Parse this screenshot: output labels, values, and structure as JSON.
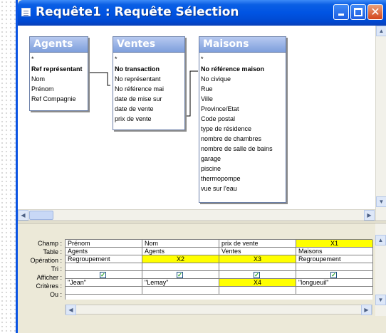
{
  "window": {
    "title": "Requête1 : Requête Sélection",
    "buttons": {
      "minimize": "minimize-icon",
      "maximize": "maximize-icon",
      "close": "close-icon"
    },
    "accent_color": "#0054e3"
  },
  "tables": [
    {
      "name": "Agents",
      "fields": [
        "*",
        "Ref représentant",
        "Nom",
        "Prénom",
        "Ref Compagnie"
      ],
      "key_field": "Ref représentant"
    },
    {
      "name": "Ventes",
      "fields": [
        "*",
        "No transaction",
        "No représentant",
        "No référence mai",
        "date de mise sur",
        "date de vente",
        "prix de vente"
      ],
      "key_field": "No transaction"
    },
    {
      "name": "Maisons",
      "fields": [
        "*",
        "No référence maison",
        "No civique",
        "Rue",
        "Ville",
        "Province/Etat",
        "Code postal",
        "type de résidence",
        "nombre de chambres",
        "nombre de salle de bains",
        "garage",
        "piscine",
        "thermopompe",
        "vue sur l'eau"
      ],
      "key_field": "No référence maison"
    }
  ],
  "grid": {
    "row_labels": [
      "Champ :",
      "Table :",
      "Opération :",
      "Tri :",
      "Afficher :",
      "Critères :",
      "Ou :"
    ],
    "highlight_color": "#ffff00",
    "columns": [
      {
        "champ": "Prénom",
        "table": "Agents",
        "operation": "Regroupement",
        "tri": "",
        "afficher": true,
        "criteres": "\"Jean\"",
        "ou": ""
      },
      {
        "champ": "Nom",
        "table": "Agents",
        "operation": "X2",
        "tri": "",
        "afficher": true,
        "criteres": "\"Lemay\"",
        "ou": ""
      },
      {
        "champ": "prix de vente",
        "table": "Ventes",
        "operation": "X3",
        "tri": "",
        "afficher": true,
        "criteres": "X4",
        "ou": ""
      },
      {
        "champ": "X1",
        "table": "Maisons",
        "operation": "Regroupement",
        "tri": "",
        "afficher": true,
        "criteres": "\"longueuil\"",
        "ou": ""
      }
    ]
  }
}
